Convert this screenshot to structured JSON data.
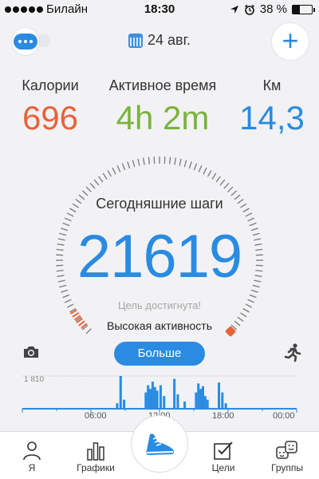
{
  "status_bar": {
    "carrier": "Билайн",
    "time": "18:30",
    "battery": "38 %",
    "battery_level": 0.38
  },
  "header": {
    "date": "24 авг."
  },
  "metrics": {
    "calories": {
      "label": "Калории",
      "value": "696"
    },
    "active_time": {
      "label": "Активное время",
      "value": "4h 2m"
    },
    "km": {
      "label": "Км",
      "value": "14,3"
    }
  },
  "steps": {
    "label": "Сегодняшние шаги",
    "value": "21619",
    "goal_text": "Цель достигнута!",
    "activity_text": "Высокая активность"
  },
  "more_button": "Больше",
  "colors": {
    "accent_blue": "#2a8be2",
    "calories_orange": "#e8623a",
    "active_green": "#7ab33c"
  },
  "chart_data": {
    "type": "bar",
    "ymax_label": "1 810",
    "x_labels": [
      "06:00",
      "12:00",
      "18:00",
      "00:00"
    ],
    "bars": [
      {
        "hour": 8.3,
        "value": 300
      },
      {
        "hour": 8.6,
        "value": 1810
      },
      {
        "hour": 8.9,
        "value": 500
      },
      {
        "hour": 10.8,
        "value": 900
      },
      {
        "hour": 11.0,
        "value": 1300
      },
      {
        "hour": 11.2,
        "value": 1100
      },
      {
        "hour": 11.4,
        "value": 1500
      },
      {
        "hour": 11.6,
        "value": 1200
      },
      {
        "hour": 11.8,
        "value": 1000
      },
      {
        "hour": 12.1,
        "value": 1300
      },
      {
        "hour": 12.4,
        "value": 700
      },
      {
        "hour": 13.3,
        "value": 1650
      },
      {
        "hour": 13.6,
        "value": 800
      },
      {
        "hour": 14.2,
        "value": 400
      },
      {
        "hour": 15.2,
        "value": 900
      },
      {
        "hour": 15.4,
        "value": 1400
      },
      {
        "hour": 15.6,
        "value": 1100
      },
      {
        "hour": 15.8,
        "value": 1250
      },
      {
        "hour": 16.0,
        "value": 700
      },
      {
        "hour": 16.2,
        "value": 500
      },
      {
        "hour": 17.2,
        "value": 1450
      },
      {
        "hour": 17.5,
        "value": 900
      },
      {
        "hour": 17.8,
        "value": 300
      }
    ],
    "ymax": 1810
  },
  "tabs": [
    {
      "label": "Я",
      "icon": "person-icon"
    },
    {
      "label": "Графики",
      "icon": "bar-chart-icon"
    },
    {
      "label": "",
      "icon": "shoe-icon"
    },
    {
      "label": "Цели",
      "icon": "checkbox-icon"
    },
    {
      "label": "Группы",
      "icon": "group-faces-icon"
    }
  ]
}
